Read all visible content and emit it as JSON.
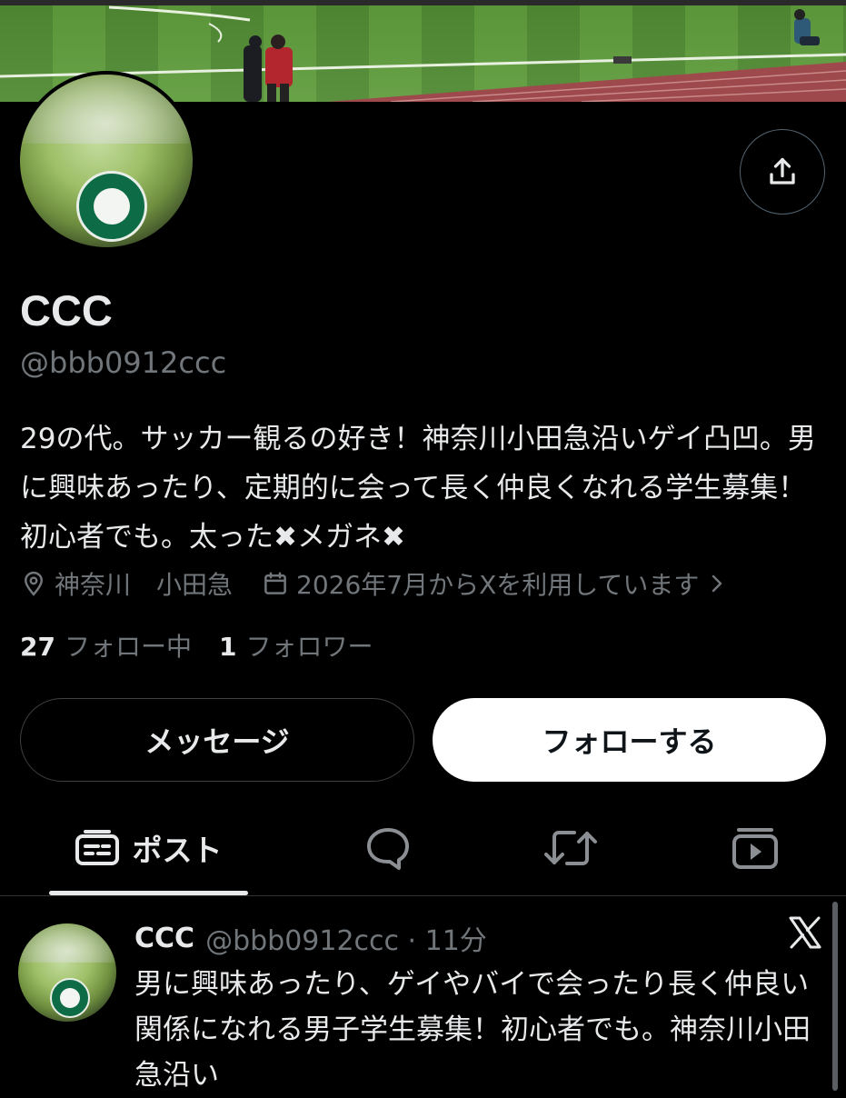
{
  "profile": {
    "name": "CCC",
    "handle": "@bbb0912ccc",
    "bio": "29の代。サッカー観るの好き！神奈川小田急沿いゲイ凸凹。男に興味あったり、定期的に会って長く仲良くなれる学生募集！初心者でも。太った✖メガネ✖",
    "location": "神奈川　小田急",
    "joined": "2026年7月からXを利用しています",
    "following_count": "27",
    "following_label": "フォロー中",
    "followers_count": "1",
    "followers_label": "フォロワー"
  },
  "actions": {
    "message_label": "メッセージ",
    "follow_label": "フォローする"
  },
  "tabs": {
    "posts_label": "ポスト"
  },
  "post": {
    "name": "CCC",
    "handle_time": "@bbb0912ccc · 11分",
    "text": "男に興味あったり、ゲイやバイで会ったり長く仲良い関係になれる男子学生募集！初心者でも。神奈川小田急沿い"
  },
  "icons": {
    "share": "share-icon",
    "location": "location-pin-icon",
    "calendar": "calendar-icon",
    "chevron": "chevron-right-icon",
    "posts": "posts-icon",
    "replies": "reply-bubble-icon",
    "reposts": "repost-icon",
    "media": "media-play-icon",
    "x_logo": "x-logo-icon"
  },
  "colors": {
    "background": "#000000",
    "text_primary": "#e7e9ea",
    "text_secondary": "#71767b",
    "follow_button_bg": "#ffffff"
  }
}
